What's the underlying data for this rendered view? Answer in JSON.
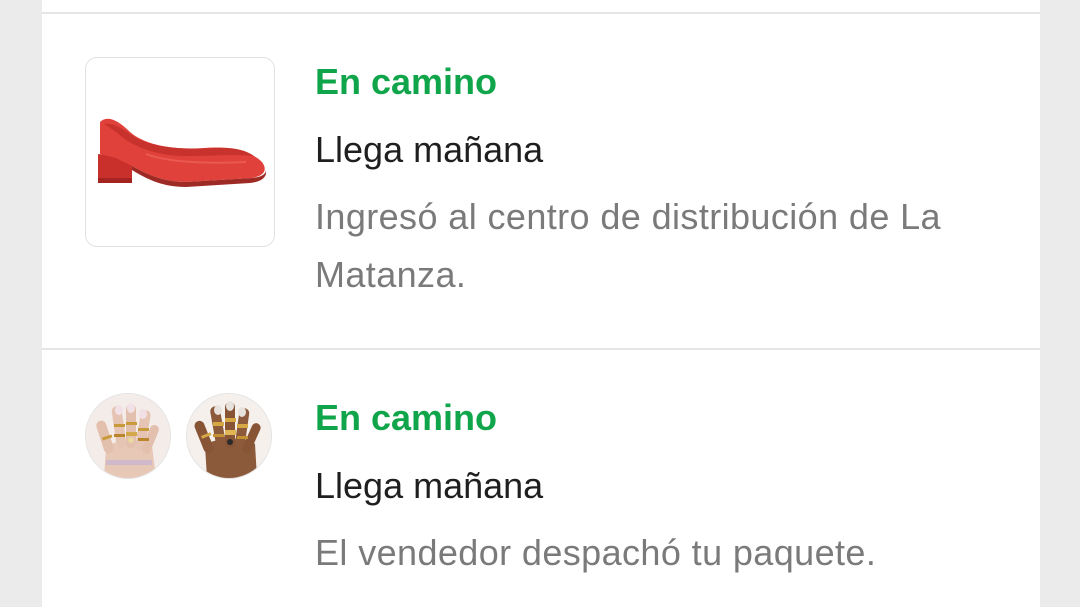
{
  "shipments": [
    {
      "status": "En camino",
      "eta": "Llega mañana",
      "detail": "Ingresó al centro de distribución de La Matanza.",
      "products": [
        {
          "image": "red-flat-shoe-image"
        }
      ]
    },
    {
      "status": "En camino",
      "eta": "Llega mañana",
      "detail": "El vendedor despachó tu paquete.",
      "products": [
        {
          "image": "rings-on-hand-image-light"
        },
        {
          "image": "rings-on-hand-image-dark"
        }
      ]
    }
  ],
  "colors": {
    "status_green": "#10a54b",
    "primary_text": "#1f1f1f",
    "secondary_text": "#7a7a7a",
    "page_background": "#ebebeb",
    "card_background": "#ffffff"
  }
}
